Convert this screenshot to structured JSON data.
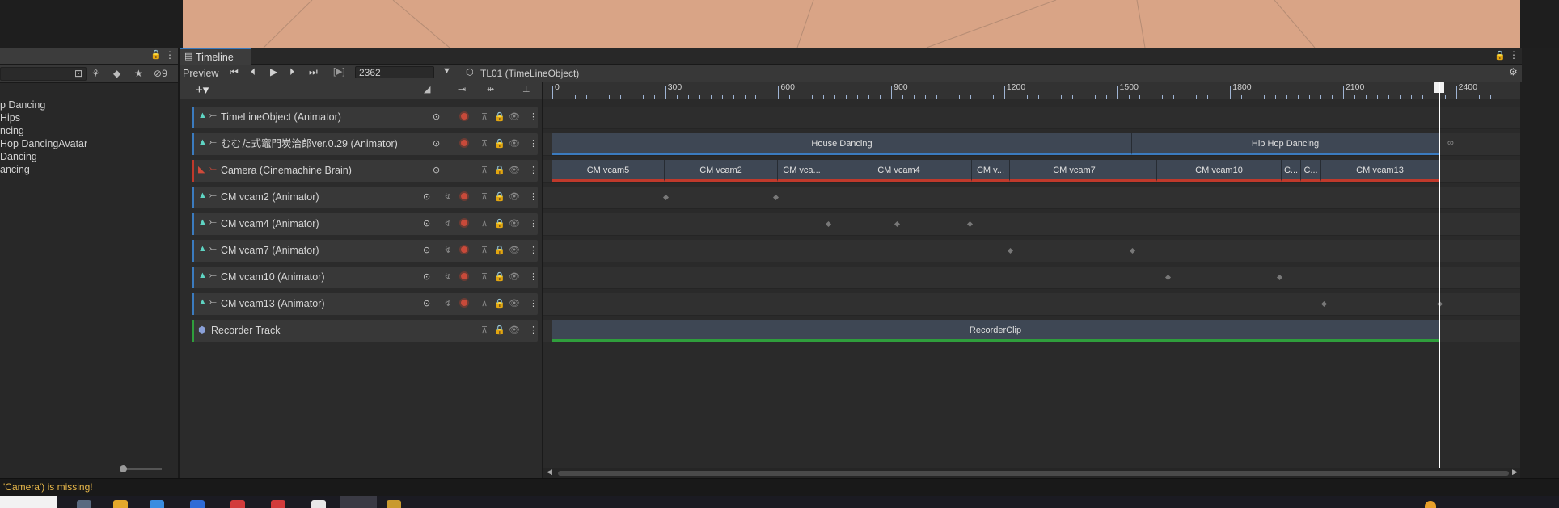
{
  "hierarchy": {
    "items": [
      "p Dancing",
      "Hips",
      "ncing",
      "Hop DancingAvatar",
      "Dancing",
      "ancing"
    ],
    "filter_count": "9"
  },
  "timeline": {
    "tab_label": "Timeline",
    "preview_label": "Preview",
    "frame_value": "2362",
    "asset_label": "TL01 (TimeLineObject)",
    "ruler_labels": [
      "0",
      "300",
      "600",
      "900",
      "1200",
      "1500",
      "1800",
      "2100",
      "2400"
    ],
    "playhead_frame": 2362,
    "tracks": [
      {
        "label": "TimeLineObject (Animator)",
        "color": "#3b7bbf"
      },
      {
        "label": "むむた式竈門炭治郎ver.0.29 (Animator)",
        "color": "#3b7bbf"
      },
      {
        "label": "Camera (Cinemachine Brain)",
        "color": "#c0392b"
      },
      {
        "label": "CM vcam2 (Animator)",
        "color": "#3b7bbf"
      },
      {
        "label": "CM vcam4 (Animator)",
        "color": "#3b7bbf"
      },
      {
        "label": "CM vcam7 (Animator)",
        "color": "#3b7bbf"
      },
      {
        "label": "CM vcam10 (Animator)",
        "color": "#3b7bbf"
      },
      {
        "label": "CM vcam13 (Animator)",
        "color": "#3b7bbf"
      },
      {
        "label": "Recorder Track",
        "color": "#2f9e3c"
      }
    ],
    "animation_clips": [
      "House Dancing",
      "Hip Hop Dancing"
    ],
    "camera_clips": [
      "CM vcam5",
      "CM vcam2",
      "CM vca...",
      "CM vcam4",
      "CM v...",
      "CM vcam7",
      "CM vcam10",
      "C...",
      "C...",
      "CM vcam13"
    ],
    "recorder_clip": "RecorderClip"
  },
  "status": {
    "message": "'Camera') is missing!"
  },
  "colors": {
    "scene_bg": "#d9a486",
    "accent_blue": "#3b7bbf",
    "camera_red": "#c0392b",
    "recorder_green": "#2f9e3c",
    "warning_yellow": "#e8b84a"
  }
}
